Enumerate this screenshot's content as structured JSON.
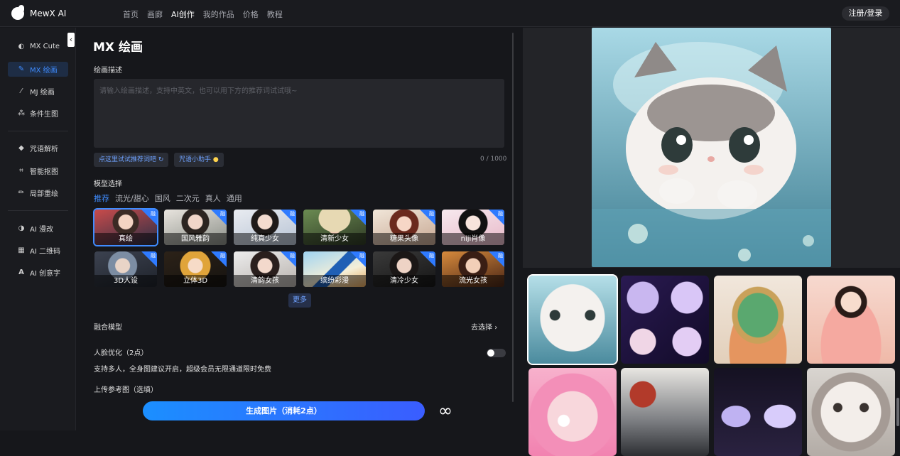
{
  "app": {
    "name": "MewX AI"
  },
  "nav": {
    "items": [
      "首页",
      "画廊",
      "AI创作",
      "我的作品",
      "价格",
      "教程"
    ],
    "active": "AI创作",
    "login_label": "注册/登录"
  },
  "sidebar": {
    "group1": [
      {
        "label": "MX Cute",
        "icon": "palette-icon"
      },
      {
        "label": "MX 绘画",
        "icon": "brush-icon",
        "active": true
      },
      {
        "label": "MJ 绘画",
        "icon": "magic-wand-icon"
      },
      {
        "label": "条件生图",
        "icon": "nodes-icon"
      }
    ],
    "group2": [
      {
        "label": "咒语解析",
        "icon": "tag-icon"
      },
      {
        "label": "智能抠图",
        "icon": "crop-icon"
      },
      {
        "label": "局部重绘",
        "icon": "pen-icon"
      }
    ],
    "group3": [
      {
        "label": "AI 漫改",
        "icon": "contrast-icon"
      },
      {
        "label": "AI 二维码",
        "icon": "qrcode-icon"
      },
      {
        "label": "AI 创意字",
        "icon": "letter-icon"
      }
    ],
    "collapse_glyph": "‹"
  },
  "form": {
    "title": "MX 绘画",
    "prompt_label": "绘画描述",
    "prompt_placeholder": "请输入绘画描述，支持中英文，也可以用下方的推荐词试试哦~",
    "chip_recommend": "点这里试试推荐词吧",
    "chip_helper": "咒语小助手",
    "counter": "0 / 1000",
    "model_label": "模型选择",
    "model_tabs": [
      "推荐",
      "流光/甜心",
      "国风",
      "二次元",
      "真人",
      "通用"
    ],
    "model_tab_active": "推荐",
    "badge": "融",
    "models": [
      "真绘",
      "国风雅韵",
      "纯真少女",
      "清新少女",
      "糖果头像",
      "niji肖像",
      "3D人设",
      "立体3D",
      "清韵女孩",
      "缤纷彩漫",
      "清冷少女",
      "流光女孩"
    ],
    "more_label": "更多",
    "fusion_label": "融合模型",
    "fusion_action": "去选择",
    "face_label": "人脸优化（2点）",
    "face_desc": "支持多人，全身图建议开启，超级会员无限通道限时免费",
    "face_opt_enabled": false,
    "ref_label": "上传参考图（选填）",
    "generate_label": "生成图片（消耗2点）",
    "infinity_glyph": "∞"
  },
  "colors": {
    "accent": "#3f8cff",
    "bg": "#16171b",
    "panel": "#1a1b1f",
    "gen_start": "#1b8fff",
    "gen_end": "#3a5dff"
  }
}
